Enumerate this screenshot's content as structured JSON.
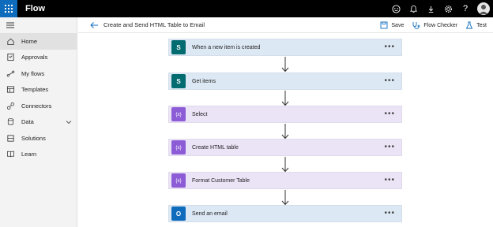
{
  "app": {
    "title": "Flow"
  },
  "topbar": {
    "icons": [
      "smiley-icon",
      "bell-icon",
      "download-icon",
      "settings-icon",
      "help-icon",
      "avatar"
    ],
    "help_glyph": "?"
  },
  "sidebar": {
    "items": [
      {
        "label": "Home",
        "icon": "home-icon",
        "active": true
      },
      {
        "label": "Approvals",
        "icon": "approvals-icon"
      },
      {
        "label": "My flows",
        "icon": "flows-icon"
      },
      {
        "label": "Templates",
        "icon": "templates-icon"
      },
      {
        "label": "Connectors",
        "icon": "connectors-icon"
      },
      {
        "label": "Data",
        "icon": "data-icon",
        "expandable": true
      },
      {
        "label": "Solutions",
        "icon": "solutions-icon"
      },
      {
        "label": "Learn",
        "icon": "learn-icon"
      }
    ]
  },
  "commandbar": {
    "flow_name": "Create and Send HTML Table to Email",
    "save_label": "Save",
    "checker_label": "Flow Checker",
    "test_label": "Test"
  },
  "steps": [
    {
      "title": "When a new item is created",
      "kind": "sharepoint",
      "icon_letter": "S"
    },
    {
      "title": "Get items",
      "kind": "sharepoint",
      "icon_letter": "S"
    },
    {
      "title": "Select",
      "kind": "data-operation",
      "icon_letter": "{x}"
    },
    {
      "title": "Create HTML table",
      "kind": "data-operation",
      "icon_letter": "{x}"
    },
    {
      "title": "Format Customer Table",
      "kind": "data-operation",
      "icon_letter": "{x}"
    },
    {
      "title": "Send an email",
      "kind": "outlook",
      "icon_letter": "O"
    }
  ],
  "more_glyph": "•••",
  "colors": {
    "topbar": "#000000",
    "waffle": "#0f6cbd",
    "sharepoint": "#036c70",
    "data_operation": "#8c5cd6",
    "outlook": "#0f6cbd",
    "card_blue": "#dce8f4",
    "card_purple": "#ebe3f6",
    "link_blue": "#0f6cbd"
  }
}
